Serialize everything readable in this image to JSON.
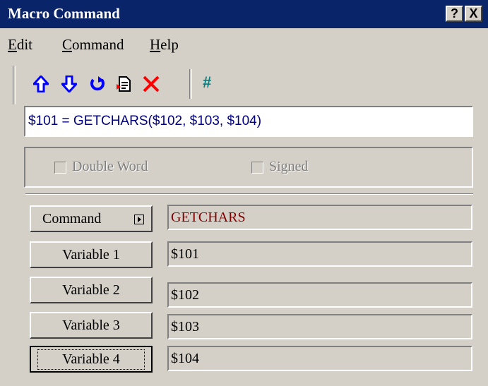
{
  "window": {
    "title": "Macro Command",
    "help_button": "?",
    "close_button": "X"
  },
  "menu": [
    {
      "label": "Edit",
      "accel": "E",
      "rest": "dit"
    },
    {
      "label": "Command",
      "accel": "C",
      "rest": "ommand"
    },
    {
      "label": "Help",
      "accel": "H",
      "rest": "elp"
    }
  ],
  "toolbar": {
    "icons": [
      "arrow-up-icon",
      "arrow-down-icon",
      "undo-icon",
      "document-icon",
      "delete-icon"
    ],
    "hash_label": "#"
  },
  "command_line": {
    "value": "$101 = GETCHARS($102, $103, $104)"
  },
  "options": {
    "double_word": {
      "label": "Double Word",
      "checked": false,
      "enabled": false
    },
    "signed": {
      "label": "Signed",
      "checked": false,
      "enabled": false
    }
  },
  "rows": [
    {
      "button": "Command",
      "value": "GETCHARS"
    },
    {
      "button": "Variable 1",
      "value": "$101"
    },
    {
      "button": "Variable 2",
      "value": "$102"
    },
    {
      "button": "Variable 3",
      "value": "$103"
    },
    {
      "button": "Variable 4",
      "value": "$104"
    }
  ],
  "colors": {
    "title_bar": "#0a246a",
    "window_face": "#d4d0c8",
    "command_text": "#800000",
    "expression_text": "#000080",
    "toolbar_blue": "#0000ff",
    "toolbar_red": "#ff0000",
    "hash_teal": "#008080"
  }
}
